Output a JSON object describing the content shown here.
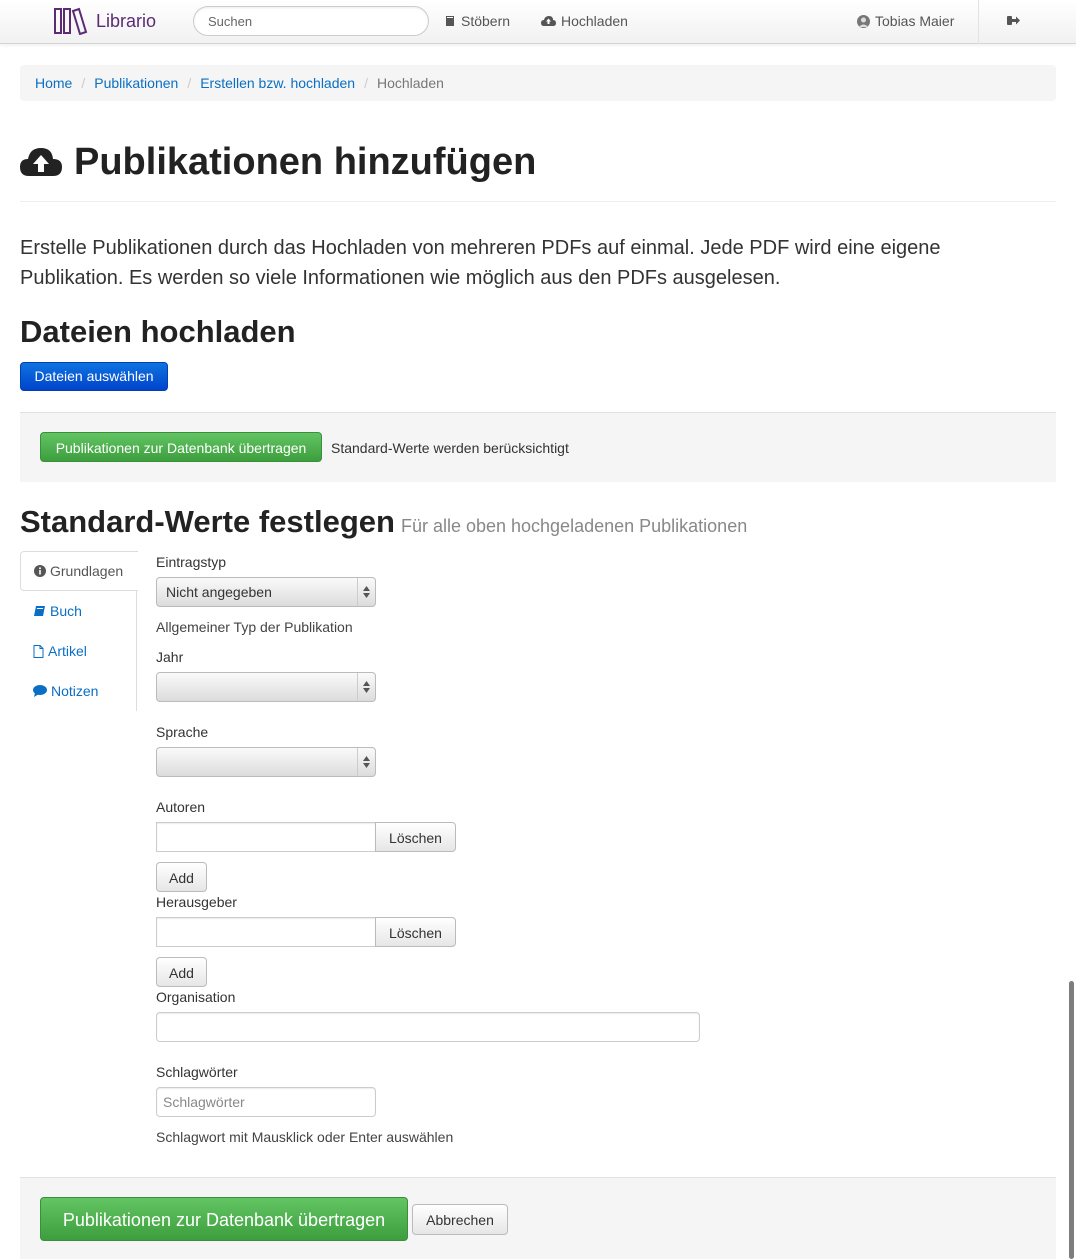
{
  "navbar": {
    "brand": "Librario",
    "search_placeholder": "Suchen",
    "browse": "Stöbern",
    "upload": "Hochladen",
    "user": "Tobias Maier"
  },
  "breadcrumb": [
    "Home",
    "Publikationen",
    "Erstellen bzw. hochladen",
    "Hochladen"
  ],
  "page_title": "Publikationen hinzufügen",
  "lead": "Erstelle Publikationen durch das Hochladen von mehreren PDFs auf einmal. Jede PDF wird eine eigene Publikation. Es werden so viele Informationen wie möglich aus den PDFs ausgelesen.",
  "upload_section": {
    "title": "Dateien hochladen",
    "choose_files": "Dateien auswählen",
    "submit": "Publikationen zur Datenbank übertragen",
    "note": "Standard-Werte werden berücksichtigt"
  },
  "defaults_section": {
    "title": "Standard-Werte festlegen",
    "subtitle": "Für alle oben hochgeladenen Publikationen"
  },
  "tabs": [
    "Grundlagen",
    "Buch",
    "Artikel",
    "Notizen"
  ],
  "form": {
    "entry_type_label": "Eintragstyp",
    "entry_type_value": "Nicht angegeben",
    "entry_type_help": "Allgemeiner Typ der Publikation",
    "year_label": "Jahr",
    "year_value": "",
    "language_label": "Sprache",
    "language_value": "",
    "authors_label": "Autoren",
    "authors_value": "",
    "editors_label": "Herausgeber",
    "editors_value": "",
    "delete_label": "Löschen",
    "add_label": "Add",
    "organisation_label": "Organisation",
    "organisation_value": "",
    "keywords_label": "Schlagwörter",
    "keywords_placeholder": "Schlagwörter",
    "keywords_help": "Schlagwort mit Mausklick oder Enter auswählen"
  },
  "footer_actions": {
    "submit": "Publikationen zur Datenbank übertragen",
    "cancel": "Abbrechen"
  },
  "colors": {
    "brand": "#5b2b74",
    "link": "#0a6fc4",
    "primary": "#0044cc",
    "success": "#51a351"
  }
}
